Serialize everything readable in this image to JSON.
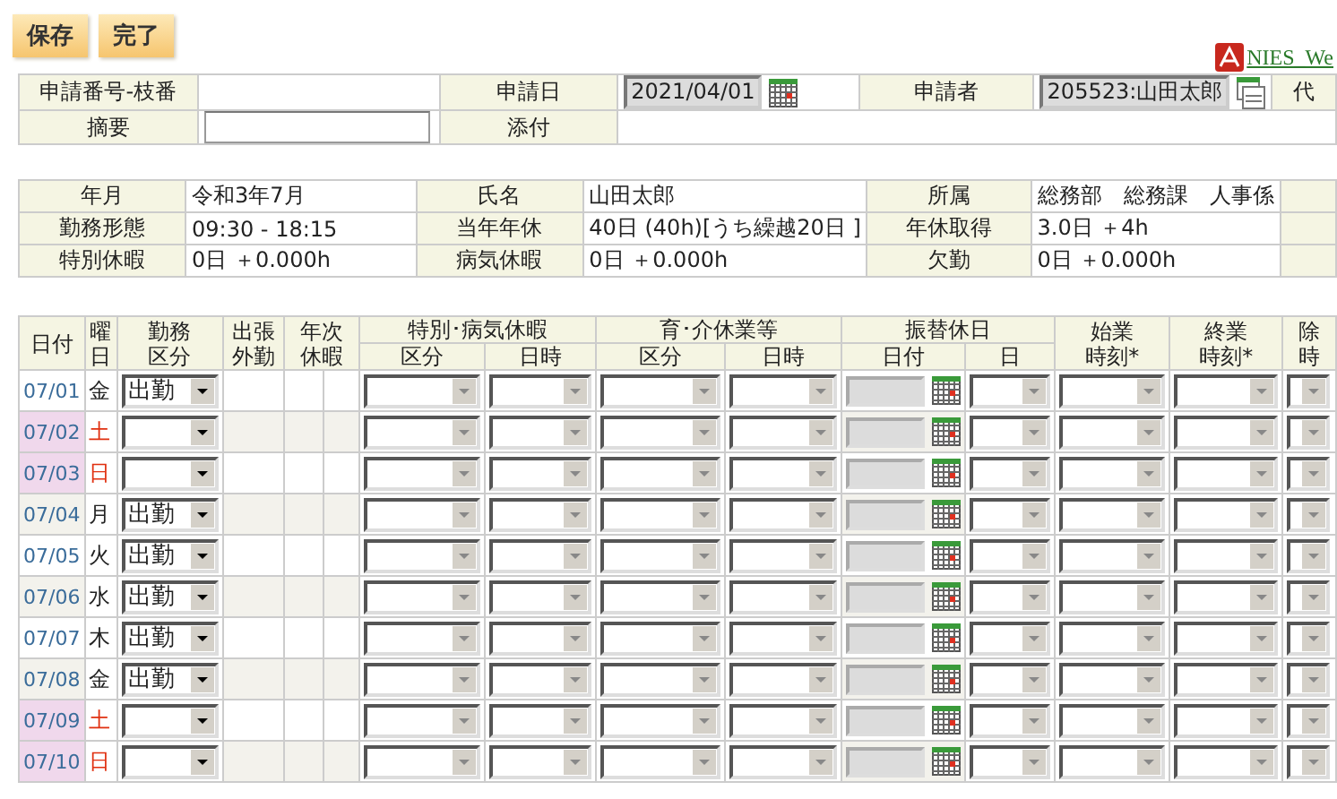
{
  "toolbar": {
    "buttons": [
      "保存",
      "完了"
    ],
    "link": "NIES_We"
  },
  "application": {
    "number_label": "申請番号-枝番",
    "date_label": "申請日",
    "date_value": "2021/04/01",
    "applicant_label": "申請者",
    "applicant_value": "205523:山田太郎",
    "column_7": "代",
    "summary_label": "摘要",
    "attachment_label": "添付"
  },
  "summary": [
    [
      {
        "label": "年月",
        "value": "令和3年7月"
      },
      {
        "label": "氏名",
        "value": "山田太郎"
      },
      {
        "label": "所属",
        "value": "総務部　総務課　人事係"
      }
    ],
    [
      {
        "label": "勤務形態",
        "value": "09:30 - 18:15"
      },
      {
        "label": "当年年休",
        "value": "40日 (40h)[うち繰越20日 ]"
      },
      {
        "label": "年休取得",
        "value": "3.0日 ＋4h"
      }
    ],
    [
      {
        "label": "特別休暇",
        "value": "0日 ＋0.000h"
      },
      {
        "label": "病気休暇",
        "value": "0日 ＋0.000h"
      },
      {
        "label": "欠勤",
        "value": "0日 ＋0.000h"
      }
    ]
  ],
  "table": {
    "columns": [
      {
        "lines": [
          "日付"
        ]
      },
      {
        "lines": [
          "曜",
          "日"
        ]
      },
      {
        "lines": [
          "勤務",
          "区分"
        ]
      },
      {
        "lines": [
          "出張",
          "外勤"
        ]
      },
      {
        "lines": [
          "年次",
          "休暇"
        ]
      },
      {
        "lines": [
          "特別･病気休暇"
        ],
        "children": [
          "区分",
          "日時"
        ]
      },
      {
        "lines": [
          "育･介休業等"
        ],
        "children": [
          "区分",
          "日時"
        ]
      },
      {
        "lines": [
          "振替休日"
        ],
        "children": [
          "日付",
          "日"
        ]
      },
      {
        "lines": [
          "始業",
          "時刻*"
        ]
      },
      {
        "lines": [
          "終業",
          "時刻*"
        ]
      },
      {
        "lines": [
          "除",
          "時"
        ]
      }
    ],
    "rows": [
      {
        "date": "07/01",
        "day": "金",
        "weekend": false,
        "work": "出勤"
      },
      {
        "date": "07/02",
        "day": "土",
        "weekend": true
      },
      {
        "date": "07/03",
        "day": "日",
        "weekend": true
      },
      {
        "date": "07/04",
        "day": "月",
        "weekend": false,
        "work": "出勤"
      },
      {
        "date": "07/05",
        "day": "火",
        "weekend": false,
        "work": "出勤"
      },
      {
        "date": "07/06",
        "day": "水",
        "weekend": false,
        "work": "出勤"
      },
      {
        "date": "07/07",
        "day": "木",
        "weekend": false,
        "work": "出勤"
      },
      {
        "date": "07/08",
        "day": "金",
        "weekend": false,
        "work": "出勤"
      },
      {
        "date": "07/09",
        "day": "土",
        "weekend": true
      },
      {
        "date": "07/10",
        "day": "日",
        "weekend": true
      }
    ]
  }
}
